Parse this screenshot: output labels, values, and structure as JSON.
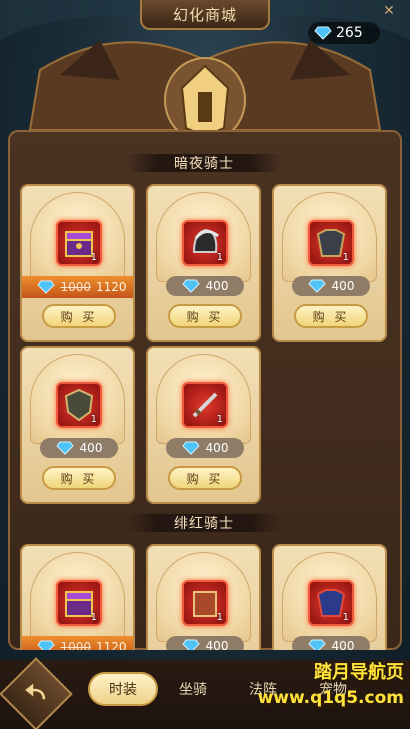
{
  "header": {
    "title": "幻化商城",
    "gem_count": "265",
    "close_icon": "x-icon"
  },
  "sections": [
    {
      "title": "暗夜骑士",
      "items": [
        {
          "icon": "treasure-chest-icon",
          "qty": "1",
          "price_old": "1000",
          "price": "1120",
          "sale": true,
          "buy_label": "购 买"
        },
        {
          "icon": "dark-helmet-icon",
          "qty": "1",
          "price": "400",
          "sale": false,
          "buy_label": "购 买"
        },
        {
          "icon": "dark-armor-icon",
          "qty": "1",
          "price": "400",
          "sale": false,
          "buy_label": "购 买"
        },
        {
          "icon": "shield-icon",
          "qty": "1",
          "price": "400",
          "sale": false,
          "buy_label": "购 买"
        },
        {
          "icon": "sword-icon",
          "qty": "1",
          "price": "400",
          "sale": false,
          "buy_label": "购 买"
        }
      ]
    },
    {
      "title": "绯红骑士",
      "items": [
        {
          "icon": "treasure-chest-icon",
          "qty": "1",
          "price_old": "1000",
          "price": "1120",
          "sale": true
        },
        {
          "icon": "scroll-icon",
          "qty": "1",
          "price": "400",
          "sale": false
        },
        {
          "icon": "red-armor-icon",
          "qty": "1",
          "price": "400",
          "sale": false
        }
      ]
    }
  ],
  "bottom_nav": {
    "back_icon": "back-arrow-icon",
    "tabs": [
      {
        "label": "时装",
        "active": true
      },
      {
        "label": "坐骑",
        "active": false
      },
      {
        "label": "法阵",
        "active": false
      },
      {
        "label": "宠物",
        "active": false
      }
    ]
  },
  "watermark": {
    "title": "踏月导航页",
    "url": "www.q1q5.com"
  },
  "colors": {
    "gem": "#4fc3f7",
    "sale_ribbon": "#e07a24",
    "item_frame": "#c8231a"
  }
}
